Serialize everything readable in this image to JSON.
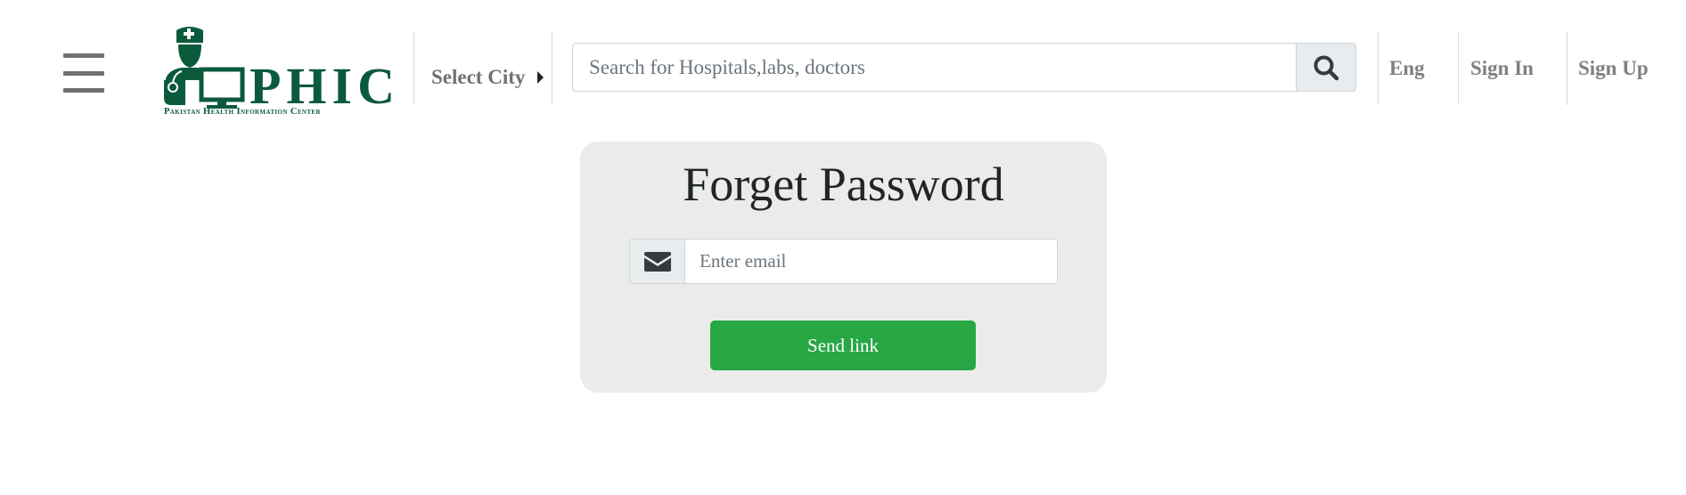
{
  "header": {
    "logo": {
      "name": "PHIC",
      "tagline": "Pakistan Health Information Center",
      "color": "#0b5a3c"
    },
    "city_selector": {
      "label": "Select City",
      "icon": "caret-right-icon"
    },
    "search": {
      "placeholder": "Search for Hospitals,labs, doctors",
      "value": "",
      "button_icon": "search-icon"
    },
    "nav": [
      {
        "label": "Eng"
      },
      {
        "label": "Sign In"
      },
      {
        "label": "Sign Up"
      }
    ],
    "menu_icon": "hamburger-menu-icon"
  },
  "forget_password": {
    "title": "Forget Password",
    "email": {
      "placeholder": "Enter email",
      "value": "",
      "icon": "envelope-icon"
    },
    "submit_label": "Send link",
    "submit_color": "#28a745"
  }
}
